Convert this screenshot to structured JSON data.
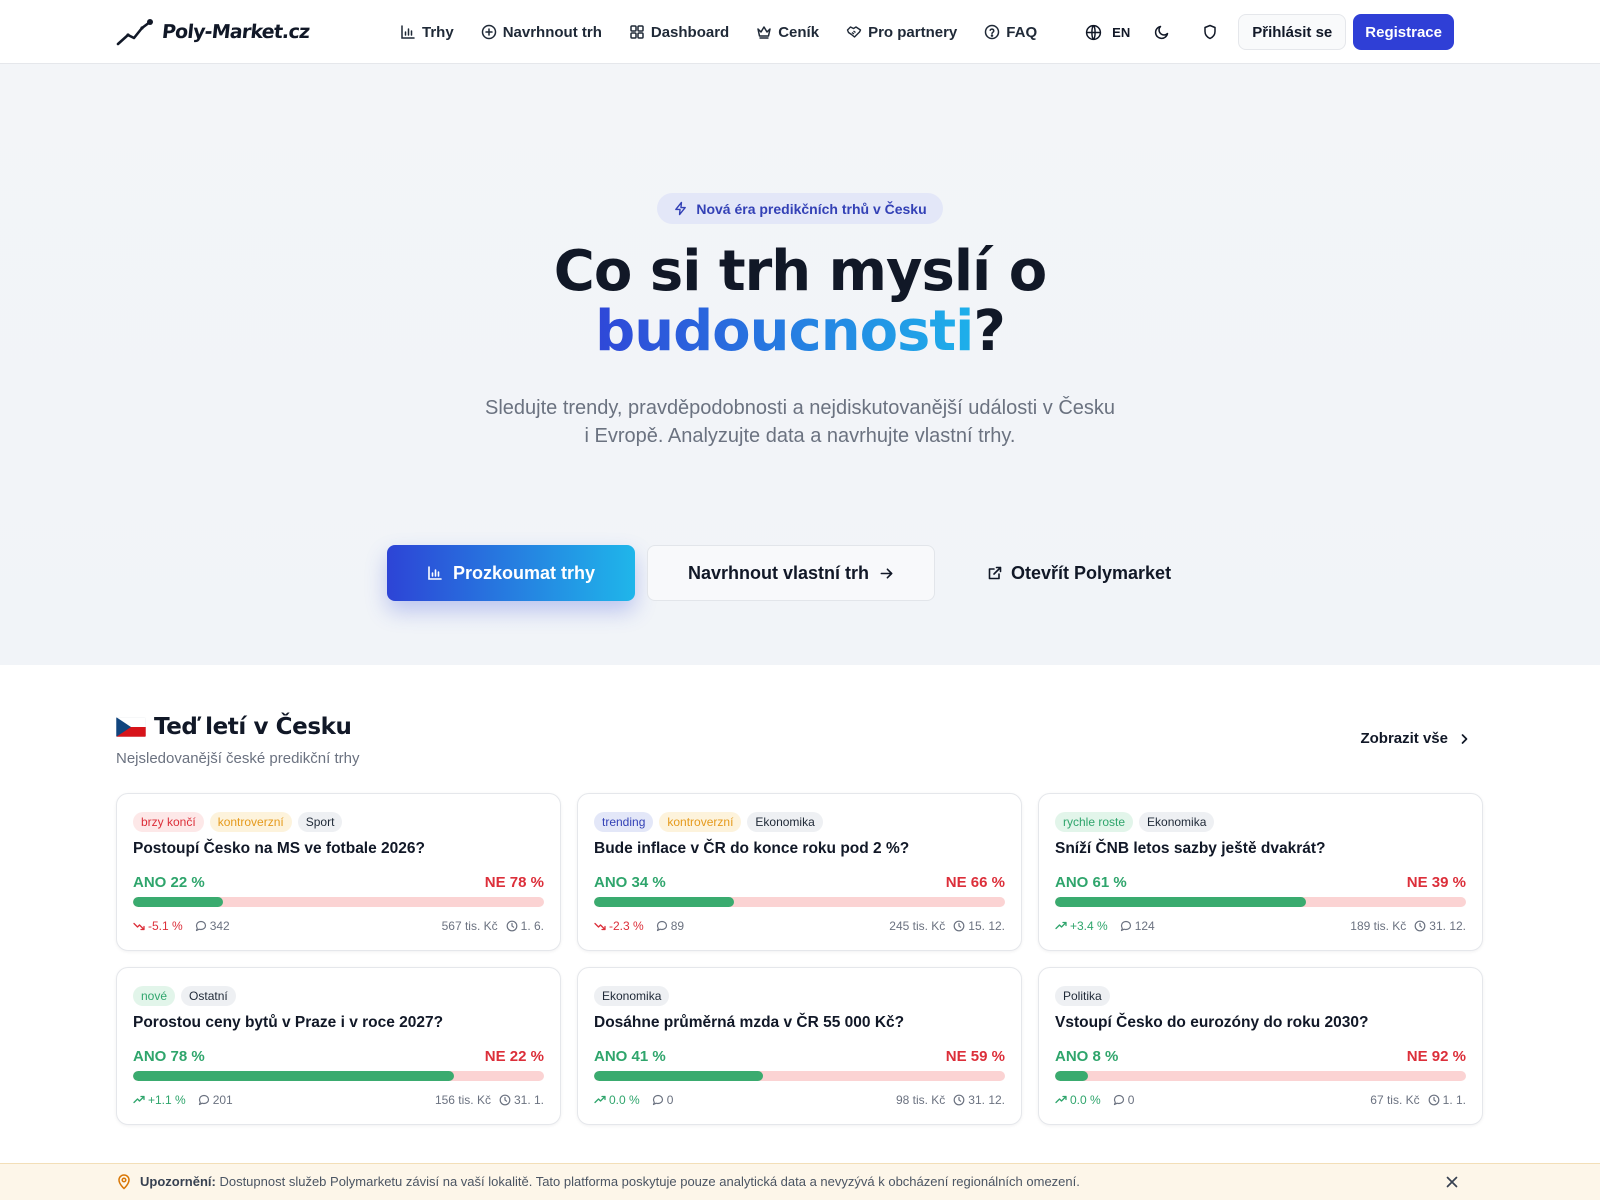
{
  "colors": {
    "accent": "#2f3fd6",
    "gradient_start": "#2d44d6",
    "gradient_end": "#1fb6ea",
    "yes": "#2fa56c",
    "no": "#dc2f3a",
    "no_bar": "#fbd3d3",
    "notice_bg": "#fdf6e9"
  },
  "header": {
    "logo_text": "Poly-Market.cz",
    "nav": [
      {
        "label": "Trhy",
        "icon": "bar-chart-icon"
      },
      {
        "label": "Navrhnout trh",
        "icon": "plus-circle-icon"
      },
      {
        "label": "Dashboard",
        "icon": "grid-icon"
      },
      {
        "label": "Ceník",
        "icon": "crown-icon"
      },
      {
        "label": "Pro partnery",
        "icon": "handshake-icon"
      },
      {
        "label": "FAQ",
        "icon": "help-circle-icon"
      }
    ],
    "lang": "EN",
    "login_label": "Přihlásit se",
    "register_label": "Registrace"
  },
  "hero": {
    "badge": "Nová éra predikčních trhů v Česku",
    "title_line1": "Co si trh myslí o",
    "title_highlight": "budoucnosti",
    "title_end": "?",
    "subtitle": "Sledujte trendy, pravděpodobnosti a nejdiskutovanější události v Česku i Evropě. Analyzujte data a navrhujte vlastní trhy.",
    "primary_cta": "Prozkoumat trhy",
    "secondary_cta": "Navrhnout vlastní trh",
    "tertiary_cta": "Otevřít Polymarket"
  },
  "section": {
    "title": "Teď letí v Česku",
    "subtitle": "Nejsledovanější české predikční trhy",
    "show_all": "Zobrazit vše"
  },
  "markets": [
    {
      "tags": [
        {
          "label": "brzy končí",
          "type": "red"
        },
        {
          "label": "kontroverzní",
          "type": "amber"
        },
        {
          "label": "Sport",
          "type": "gray"
        }
      ],
      "title": "Postoupí Česko na MS ve fotbale 2026?",
      "yes_label": "ANO 22 %",
      "no_label": "NE 78 %",
      "yes_pct": 22,
      "change": "-5.1 %",
      "direction": "down",
      "comments": "342",
      "volume": "567 tis. Kč",
      "date": "1. 6."
    },
    {
      "tags": [
        {
          "label": "trending",
          "type": "blue"
        },
        {
          "label": "kontroverzní",
          "type": "amber"
        },
        {
          "label": "Ekonomika",
          "type": "gray"
        }
      ],
      "title": "Bude inflace v ČR do konce roku pod 2 %?",
      "yes_label": "ANO 34 %",
      "no_label": "NE 66 %",
      "yes_pct": 34,
      "change": "-2.3 %",
      "direction": "down",
      "comments": "89",
      "volume": "245 tis. Kč",
      "date": "15. 12."
    },
    {
      "tags": [
        {
          "label": "rychle roste",
          "type": "green"
        },
        {
          "label": "Ekonomika",
          "type": "gray"
        }
      ],
      "title": "Sníží ČNB letos sazby ještě dvakrát?",
      "yes_label": "ANO 61 %",
      "no_label": "NE 39 %",
      "yes_pct": 61,
      "change": "+3.4 %",
      "direction": "up",
      "comments": "124",
      "volume": "189 tis. Kč",
      "date": "31. 12."
    },
    {
      "tags": [
        {
          "label": "nové",
          "type": "green"
        },
        {
          "label": "Ostatní",
          "type": "gray"
        }
      ],
      "title": "Porostou ceny bytů v Praze i v roce 2027?",
      "yes_label": "ANO 78 %",
      "no_label": "NE 22 %",
      "yes_pct": 78,
      "change": "+1.1 %",
      "direction": "up",
      "comments": "201",
      "volume": "156 tis. Kč",
      "date": "31. 1."
    },
    {
      "tags": [
        {
          "label": "Ekonomika",
          "type": "gray"
        }
      ],
      "title": "Dosáhne průměrná mzda v ČR 55 000 Kč?",
      "yes_label": "ANO 41 %",
      "no_label": "NE 59 %",
      "yes_pct": 41,
      "change": "0.0 %",
      "direction": "up",
      "comments": "0",
      "volume": "98 tis. Kč",
      "date": "31. 12."
    },
    {
      "tags": [
        {
          "label": "Politika",
          "type": "gray"
        }
      ],
      "title": "Vstoupí Česko do eurozóny do roku 2030?",
      "yes_label": "ANO 8 %",
      "no_label": "NE 92 %",
      "yes_pct": 8,
      "change": "0.0 %",
      "direction": "up",
      "comments": "0",
      "volume": "67 tis. Kč",
      "date": "1. 1."
    }
  ],
  "notice": {
    "label": "Upozornění:",
    "text": "Dostupnost služeb Polymarketu závisí na vaší lokalitě. Tato platforma poskytuje pouze analytická data a nevyzývá k obcházení regionálních omezení."
  }
}
